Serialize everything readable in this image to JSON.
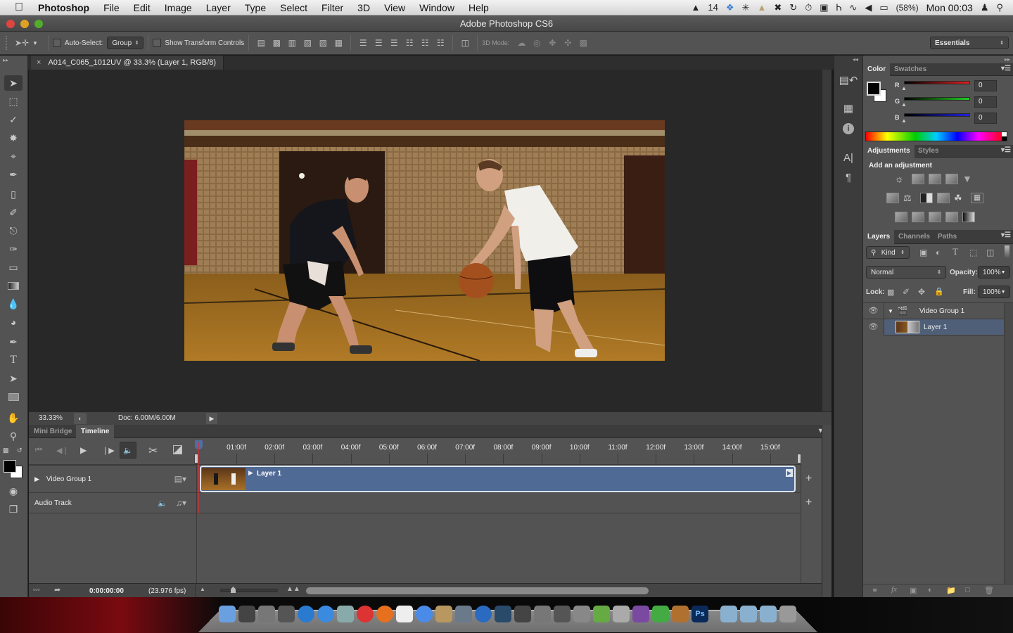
{
  "menubar": {
    "app_name": "Photoshop",
    "menus": [
      "File",
      "Edit",
      "Image",
      "Layer",
      "Type",
      "Select",
      "Filter",
      "3D",
      "View",
      "Window",
      "Help"
    ],
    "tray": {
      "adobe_count": "14",
      "battery": "(58%)",
      "clock": "Mon 00:03"
    }
  },
  "window": {
    "title": "Adobe Photoshop CS6"
  },
  "options_bar": {
    "auto_select_label": "Auto-Select:",
    "auto_select_value": "Group",
    "show_transform_label": "Show Transform Controls",
    "mode_3d_label": "3D Mode:",
    "workspace": "Essentials"
  },
  "document": {
    "tab_title": "A014_C065_1012UV @ 33.3% (Layer 1, RGB/8)",
    "zoom": "33.33%",
    "doc_size": "Doc: 6.00M/6.00M"
  },
  "timeline": {
    "tabs": [
      "Mini Bridge",
      "Timeline"
    ],
    "active_tab": "Timeline",
    "ticks": [
      "01:00f",
      "02:00f",
      "03:00f",
      "04:00f",
      "05:00f",
      "06:00f",
      "07:00f",
      "08:00f",
      "09:00f",
      "10:00f",
      "11:00f",
      "12:00f",
      "13:00f",
      "14:00f",
      "15:00f"
    ],
    "tracks": [
      {
        "name": "Video Group 1"
      },
      {
        "name": "Audio Track"
      }
    ],
    "clip_name": "Layer 1",
    "timecode": "0:00:00:00",
    "fps": "(23.976 fps)"
  },
  "color_panel": {
    "tabs": [
      "Color",
      "Swatches"
    ],
    "channels": [
      {
        "label": "R",
        "value": "0",
        "color": "#e02020"
      },
      {
        "label": "G",
        "value": "0",
        "color": "#20d020"
      },
      {
        "label": "B",
        "value": "0",
        "color": "#2020e0"
      }
    ]
  },
  "adjustments_panel": {
    "tabs": [
      "Adjustments",
      "Styles"
    ],
    "heading": "Add an adjustment"
  },
  "layers_panel": {
    "tabs": [
      "Layers",
      "Channels",
      "Paths"
    ],
    "filter_kind": "Kind",
    "blend_mode": "Normal",
    "opacity_label": "Opacity:",
    "opacity": "100%",
    "lock_label": "Lock:",
    "fill_label": "Fill:",
    "fill": "100%",
    "layers": [
      {
        "name": "Video Group 1",
        "type": "group",
        "selected": false
      },
      {
        "name": "Layer 1",
        "type": "video",
        "selected": true
      }
    ]
  },
  "colors": {
    "accent_clip": "#4f6a95",
    "playhead": "#c9343a",
    "selected_layer": "#4f5f78"
  }
}
